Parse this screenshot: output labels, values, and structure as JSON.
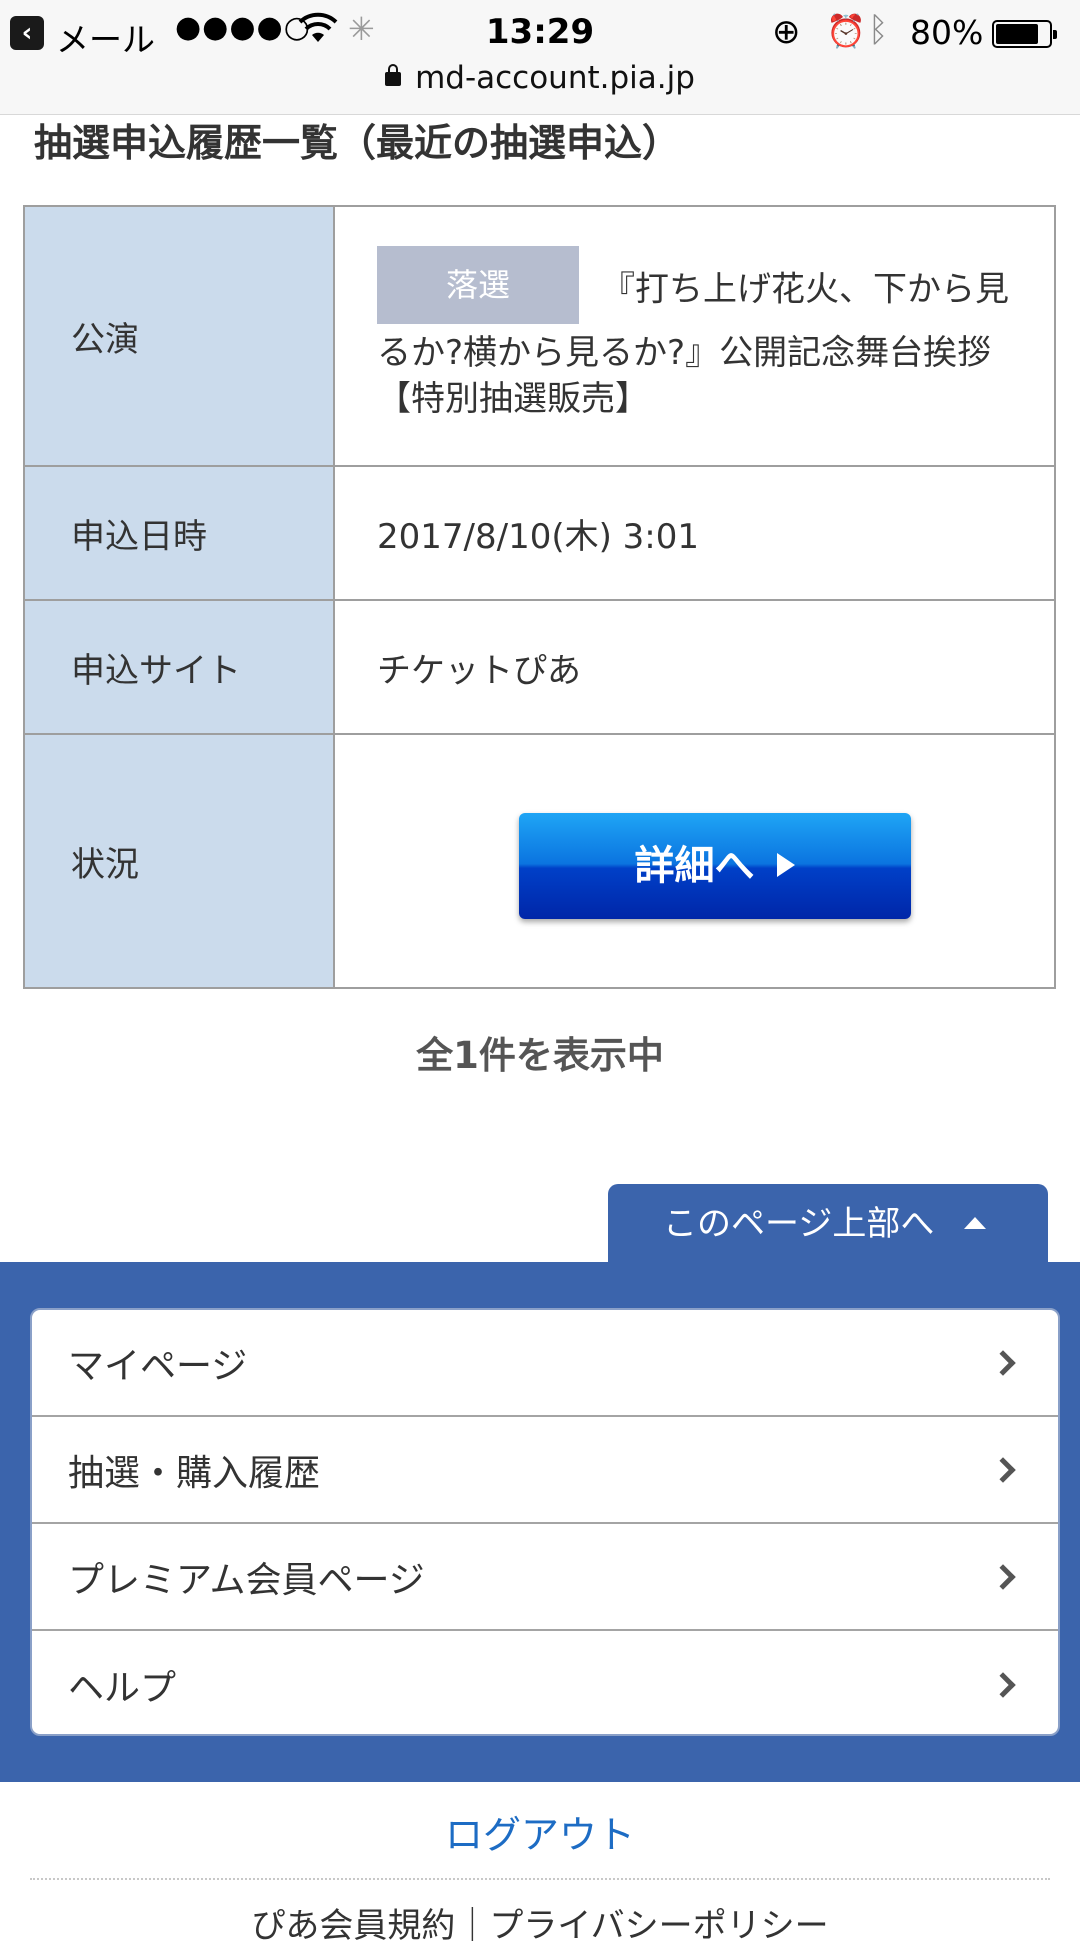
{
  "status_bar": {
    "back_app": "メール",
    "signal": "●●●●○",
    "time": "13:29",
    "battery_percent": "80%",
    "battery_level": 0.8,
    "url": "md-account.pia.jp"
  },
  "page": {
    "title": "抽選申込履歴一覧（最近の抽選申込）"
  },
  "table": {
    "rows": [
      {
        "label": "公演"
      },
      {
        "label": "申込日時",
        "value": "2017/8/10(木) 3:01"
      },
      {
        "label": "申込サイト",
        "value": "チケットぴあ"
      },
      {
        "label": "状況"
      }
    ],
    "performance": {
      "badge": "落選",
      "title": "『打ち上げ花火、下から見るか?横から見るか?』公開記念舞台挨拶【特別抽選販売】"
    },
    "detail_button": "詳細へ"
  },
  "result_count": "全1件を表示中",
  "footer": {
    "to_top": "このページ上部へ",
    "menu": [
      {
        "label": "マイページ"
      },
      {
        "label": "抽選・購入履歴"
      },
      {
        "label": "プレミアム会員ページ"
      },
      {
        "label": "ヘルプ"
      }
    ],
    "logout": "ログアウト",
    "links_text": "ぴあ会員規約｜プライバシーポリシー"
  }
}
